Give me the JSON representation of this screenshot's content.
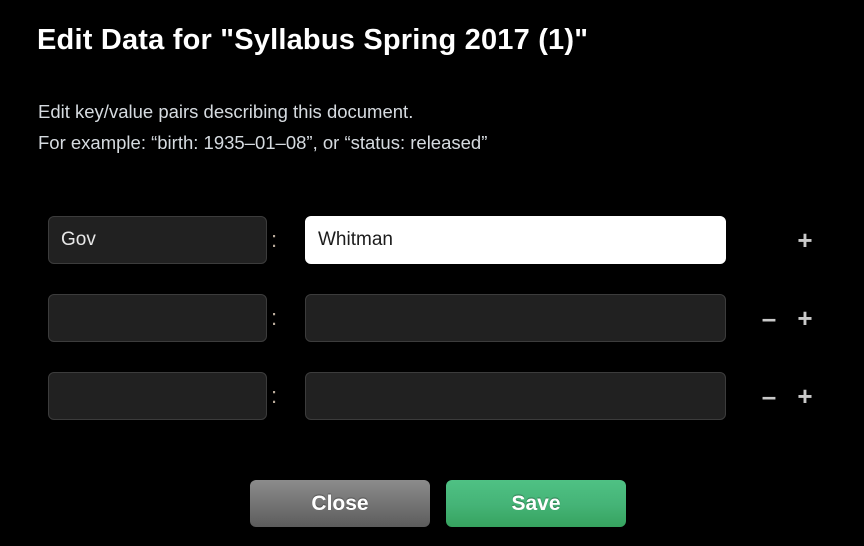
{
  "dialog": {
    "title": "Edit Data for \"Syllabus Spring 2017 (1)\"",
    "description_line1": "Edit key/value pairs describing this document.",
    "description_line2": "For example: “birth: 1935–01–08”, or “status: released”",
    "separator": ":"
  },
  "rows": [
    {
      "key_value": "Gov",
      "key_placeholder": "",
      "value_value": "Whitman",
      "value_placeholder": "",
      "value_focused": true,
      "has_remove": false,
      "has_add": true,
      "add_label": "+",
      "remove_label": "–"
    },
    {
      "key_value": "",
      "key_placeholder": "",
      "value_value": "",
      "value_placeholder": "",
      "value_focused": false,
      "has_remove": true,
      "has_add": true,
      "add_label": "+",
      "remove_label": "–"
    },
    {
      "key_value": "",
      "key_placeholder": "",
      "value_value": "",
      "value_placeholder": "",
      "value_focused": false,
      "has_remove": true,
      "has_add": true,
      "add_label": "+",
      "remove_label": "–"
    }
  ],
  "actions": {
    "close_label": "Close",
    "save_label": "Save"
  },
  "colors": {
    "background": "#000000",
    "title_text": "#ffffff",
    "description_text": "#d6dbe0",
    "field_background": "#212121",
    "field_border": "#3c3c3c",
    "focused_field_background": "#ffffff",
    "close_button": "#747474",
    "save_button": "#45b477",
    "icon_button": "#c9c9c9"
  }
}
